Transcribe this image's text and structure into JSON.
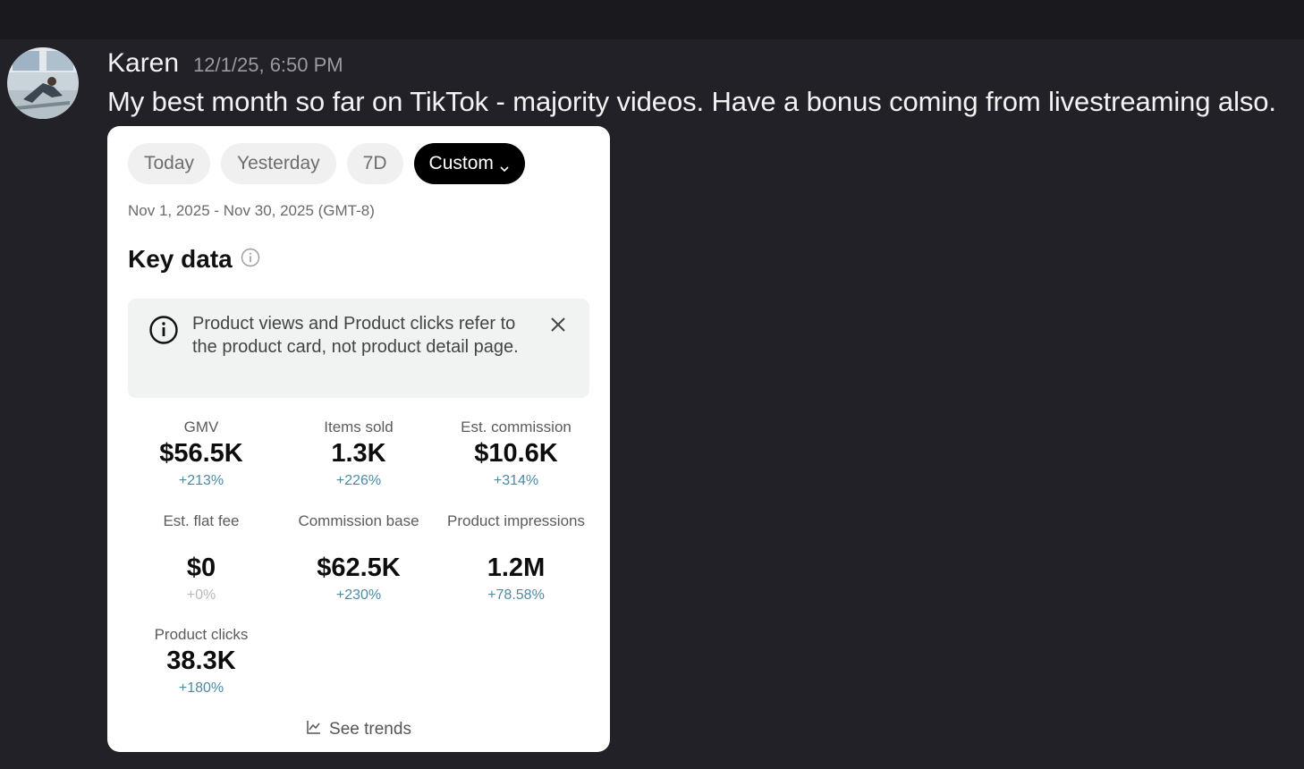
{
  "message": {
    "username": "Karen",
    "timestamp": "12/1/25, 6:50 PM",
    "text": "My best month so far on TikTok - majority videos. Have a bonus coming from livestreaming also."
  },
  "card": {
    "tabs": [
      {
        "label": "Today",
        "active": false
      },
      {
        "label": "Yesterday",
        "active": false
      },
      {
        "label": "7D",
        "active": false
      },
      {
        "label": "Custom",
        "active": true
      }
    ],
    "date_range": "Nov 1, 2025 - Nov 30, 2025 (GMT-8)",
    "section_title": "Key data",
    "notice_text": "Product views and Product clicks refer to the product card, not product detail page.",
    "metrics": [
      {
        "label": "GMV",
        "value": "$56.5K",
        "change": "+213%"
      },
      {
        "label": "Items sold",
        "value": "1.3K",
        "change": "+226%"
      },
      {
        "label": "Est. commission",
        "value": "$10.6K",
        "change": "+314%"
      },
      {
        "label": "Est. flat fee",
        "value": "$0",
        "change": "+0%"
      },
      {
        "label": "Commission base",
        "value": "$62.5K",
        "change": "+230%"
      },
      {
        "label": "Product impressions",
        "value": "1.2M",
        "change": "+78.58%"
      },
      {
        "label": "Product clicks",
        "value": "38.3K",
        "change": "+180%"
      }
    ],
    "see_trends": "See trends"
  },
  "colors": {
    "background": "#222127",
    "change_positive": "#4f8aa3",
    "change_neutral": "#b8b8b8"
  }
}
